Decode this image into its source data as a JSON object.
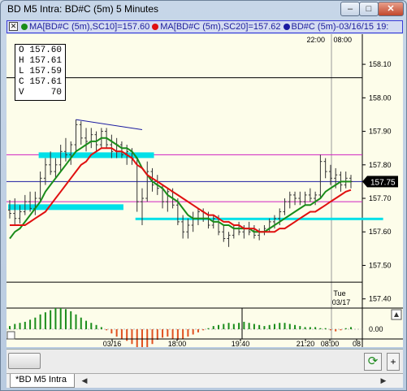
{
  "window": {
    "title": "BD M5 Intra: BD#C (5m) 5 Minutes",
    "min_label": "–",
    "max_label": "□",
    "close_label": "✕"
  },
  "legend": {
    "close_glyph": "✕",
    "items": [
      {
        "text": "MA[BD#C (5m),SC10]=157.60",
        "color": "#1a8c1a"
      },
      {
        "text": "MA[BD#C (5m),SC20]=157.62",
        "color": "#e01010"
      },
      {
        "text": "BD#C (5m)-03/16/15 19:",
        "color": "#1a1aa0"
      }
    ]
  },
  "ohlc": [
    {
      "label": "O",
      "value": "157.60"
    },
    {
      "label": "H",
      "value": "157.61"
    },
    {
      "label": "L",
      "value": "157.59"
    },
    {
      "label": "C",
      "value": "157.61"
    },
    {
      "label": "V",
      "value": "70"
    }
  ],
  "chart_data": {
    "type": "line",
    "title": "BD M5 Intra: BD#C (5m) 5 Minutes",
    "xlabel": "",
    "ylabel": "",
    "ylim": [
      157.375,
      158.19
    ],
    "y_ticks": [
      "158.10",
      "158.00",
      "157.90",
      "157.80",
      "157.70",
      "157.60",
      "157.50",
      "157.40"
    ],
    "x_ticks": [
      "03/16",
      "18:00",
      "19:40",
      "21:20",
      "08:00",
      "08"
    ],
    "top_time_labels": [
      "22:00",
      "08:00"
    ],
    "session_label": [
      "Tue",
      "03/17"
    ],
    "last_price_label": "157.75",
    "last_price": 157.75,
    "hlines": [
      {
        "value": 158.06,
        "color": "#000000"
      },
      {
        "value": 157.83,
        "color": "#d020c0"
      },
      {
        "value": 157.75,
        "color": "#1a1aa0"
      },
      {
        "value": 157.69,
        "color": "#d020c0"
      },
      {
        "value": 157.45,
        "color": "#000000"
      }
    ],
    "zones": [
      {
        "from_bar": 6,
        "to_bar": 28,
        "value": 157.83
      },
      {
        "from_bar": 0,
        "to_bar": 22,
        "value": 157.675
      },
      {
        "from_bar": 25,
        "to_bar": 73,
        "value": 157.635
      }
    ],
    "trendline": {
      "from_bar": 13,
      "from_value": 157.935,
      "to_bar": 26,
      "to_value": 157.905
    },
    "bars": [
      [
        157.665,
        157.695,
        157.64,
        157.655
      ],
      [
        157.655,
        157.7,
        157.62,
        157.64
      ],
      [
        157.64,
        157.68,
        157.625,
        157.66
      ],
      [
        157.66,
        157.71,
        157.65,
        157.69
      ],
      [
        157.69,
        157.72,
        157.66,
        157.67
      ],
      [
        157.67,
        157.72,
        157.65,
        157.7
      ],
      [
        157.7,
        157.78,
        157.69,
        157.76
      ],
      [
        157.76,
        157.82,
        157.74,
        157.8
      ],
      [
        157.8,
        157.84,
        157.77,
        157.78
      ],
      [
        157.78,
        157.82,
        157.76,
        157.8
      ],
      [
        157.8,
        157.86,
        157.78,
        157.84
      ],
      [
        157.84,
        157.88,
        157.81,
        157.83
      ],
      [
        157.83,
        157.87,
        157.8,
        157.86
      ],
      [
        157.86,
        157.935,
        157.84,
        157.92
      ],
      [
        157.92,
        157.93,
        157.86,
        157.88
      ],
      [
        157.88,
        157.91,
        157.84,
        157.87
      ],
      [
        157.87,
        157.91,
        157.85,
        157.89
      ],
      [
        157.89,
        157.9,
        157.84,
        157.86
      ],
      [
        157.86,
        157.91,
        157.85,
        157.9
      ],
      [
        157.9,
        157.91,
        157.85,
        157.86
      ],
      [
        157.86,
        157.89,
        157.82,
        157.84
      ],
      [
        157.84,
        157.88,
        157.82,
        157.86
      ],
      [
        157.86,
        157.87,
        157.82,
        157.83
      ],
      [
        157.83,
        157.86,
        157.8,
        157.84
      ],
      [
        157.84,
        157.85,
        157.8,
        157.82
      ],
      [
        157.82,
        157.82,
        157.66,
        157.69
      ],
      [
        157.69,
        157.73,
        157.62,
        157.7
      ],
      [
        157.7,
        157.81,
        157.69,
        157.78
      ],
      [
        157.78,
        157.79,
        157.72,
        157.74
      ],
      [
        157.74,
        157.77,
        157.71,
        157.73
      ],
      [
        157.73,
        157.74,
        157.67,
        157.69
      ],
      [
        157.69,
        157.73,
        157.66,
        157.72
      ],
      [
        157.72,
        157.73,
        157.67,
        157.68
      ],
      [
        157.68,
        157.7,
        157.62,
        157.63
      ],
      [
        157.63,
        157.65,
        157.58,
        157.6
      ],
      [
        157.6,
        157.64,
        157.58,
        157.62
      ],
      [
        157.62,
        157.66,
        157.6,
        157.64
      ],
      [
        157.64,
        157.67,
        157.62,
        157.66
      ],
      [
        157.66,
        157.67,
        157.63,
        157.64
      ],
      [
        157.64,
        157.66,
        157.61,
        157.62
      ],
      [
        157.62,
        157.65,
        157.61,
        157.64
      ],
      [
        157.64,
        157.65,
        157.59,
        157.6
      ],
      [
        157.6,
        157.62,
        157.57,
        157.58
      ],
      [
        157.58,
        157.6,
        157.555,
        157.59
      ],
      [
        157.59,
        157.62,
        157.58,
        157.61
      ],
      [
        157.61,
        157.63,
        157.59,
        157.6
      ],
      [
        157.6,
        157.62,
        157.58,
        157.61
      ],
      [
        157.61,
        157.63,
        157.59,
        157.6
      ],
      [
        157.6,
        157.62,
        157.58,
        157.59
      ],
      [
        157.59,
        157.61,
        157.575,
        157.6
      ],
      [
        157.6,
        157.62,
        157.59,
        157.61
      ],
      [
        157.61,
        157.64,
        157.6,
        157.63
      ],
      [
        157.63,
        157.65,
        157.61,
        157.64
      ],
      [
        157.64,
        157.67,
        157.62,
        157.66
      ],
      [
        157.66,
        157.7,
        157.65,
        157.69
      ],
      [
        157.69,
        157.72,
        157.67,
        157.71
      ],
      [
        157.71,
        157.72,
        157.68,
        157.7
      ],
      [
        157.7,
        157.72,
        157.68,
        157.69
      ],
      [
        157.69,
        157.72,
        157.68,
        157.71
      ],
      [
        157.71,
        157.73,
        157.69,
        157.7
      ],
      [
        157.7,
        157.72,
        157.68,
        157.71
      ],
      [
        157.71,
        157.83,
        157.7,
        157.81
      ],
      [
        157.81,
        157.82,
        157.76,
        157.78
      ],
      [
        157.78,
        157.8,
        157.74,
        157.76
      ],
      [
        157.76,
        157.79,
        157.73,
        157.77
      ],
      [
        157.77,
        157.78,
        157.72,
        157.74
      ],
      [
        157.74,
        157.78,
        157.73,
        157.76
      ],
      [
        157.76,
        157.77,
        157.73,
        157.75
      ]
    ],
    "series": [
      {
        "name": "MA[BD#C (5m),SC10]",
        "color": "#1a8c1a",
        "values": [
          157.58,
          157.6,
          157.61,
          157.63,
          157.65,
          157.67,
          157.69,
          157.72,
          157.74,
          157.76,
          157.78,
          157.8,
          157.82,
          157.84,
          157.85,
          157.86,
          157.87,
          157.87,
          157.88,
          157.88,
          157.87,
          157.86,
          157.85,
          157.85,
          157.84,
          157.82,
          157.79,
          157.77,
          157.75,
          157.74,
          157.73,
          157.71,
          157.7,
          157.69,
          157.67,
          157.65,
          157.64,
          157.64,
          157.64,
          157.64,
          157.63,
          157.63,
          157.62,
          157.62,
          157.61,
          157.61,
          157.61,
          157.61,
          157.6,
          157.6,
          157.6,
          157.61,
          157.62,
          157.63,
          157.64,
          157.65,
          157.66,
          157.67,
          157.68,
          157.68,
          157.69,
          157.7,
          157.72,
          157.73,
          157.74,
          157.75,
          157.75,
          157.75
        ]
      },
      {
        "name": "MA[BD#C (5m),SC20]",
        "color": "#e01010",
        "values": [
          157.62,
          157.62,
          157.62,
          157.62,
          157.63,
          157.64,
          157.65,
          157.66,
          157.68,
          157.7,
          157.72,
          157.74,
          157.76,
          157.78,
          157.8,
          157.81,
          157.83,
          157.84,
          157.85,
          157.85,
          157.85,
          157.84,
          157.84,
          157.83,
          157.82,
          157.8,
          157.79,
          157.77,
          157.76,
          157.75,
          157.74,
          157.73,
          157.72,
          157.71,
          157.7,
          157.69,
          157.68,
          157.67,
          157.66,
          157.65,
          157.65,
          157.64,
          157.63,
          157.63,
          157.62,
          157.62,
          157.61,
          157.61,
          157.61,
          157.6,
          157.6,
          157.6,
          157.6,
          157.61,
          157.61,
          157.62,
          157.63,
          157.64,
          157.65,
          157.66,
          157.66,
          157.67,
          157.68,
          157.69,
          157.7,
          157.71,
          157.72,
          157.725
        ]
      }
    ],
    "oscillator": {
      "zero_label": "0.00",
      "values": [
        0.15,
        0.25,
        0.3,
        0.35,
        0.45,
        0.55,
        0.7,
        0.8,
        0.9,
        1.0,
        1.0,
        0.95,
        0.85,
        0.7,
        0.55,
        0.4,
        0.3,
        0.2,
        0.1,
        -0.05,
        -0.2,
        -0.35,
        -0.45,
        -0.55,
        -0.7,
        -0.9,
        -1.0,
        -0.9,
        -0.7,
        -0.5,
        -0.4,
        -0.35,
        -0.45,
        -0.5,
        -0.45,
        -0.35,
        -0.25,
        -0.15,
        -0.05,
        0.05,
        0.15,
        0.2,
        0.25,
        0.3,
        0.25,
        0.3,
        0.35,
        0.3,
        0.25,
        0.2,
        0.15,
        0.2,
        0.25,
        0.3,
        0.3,
        0.25,
        0.2,
        0.15,
        0.1,
        0.1,
        0.1,
        0.05,
        0.05,
        -0.05,
        -0.1,
        -0.05,
        0.05,
        0.1
      ]
    }
  },
  "bottom": {
    "refresh_glyph": "⟳",
    "plus_glyph": "+"
  },
  "tabs": {
    "active": "*BD M5 Intra",
    "prev": "◀",
    "next": "▶"
  }
}
